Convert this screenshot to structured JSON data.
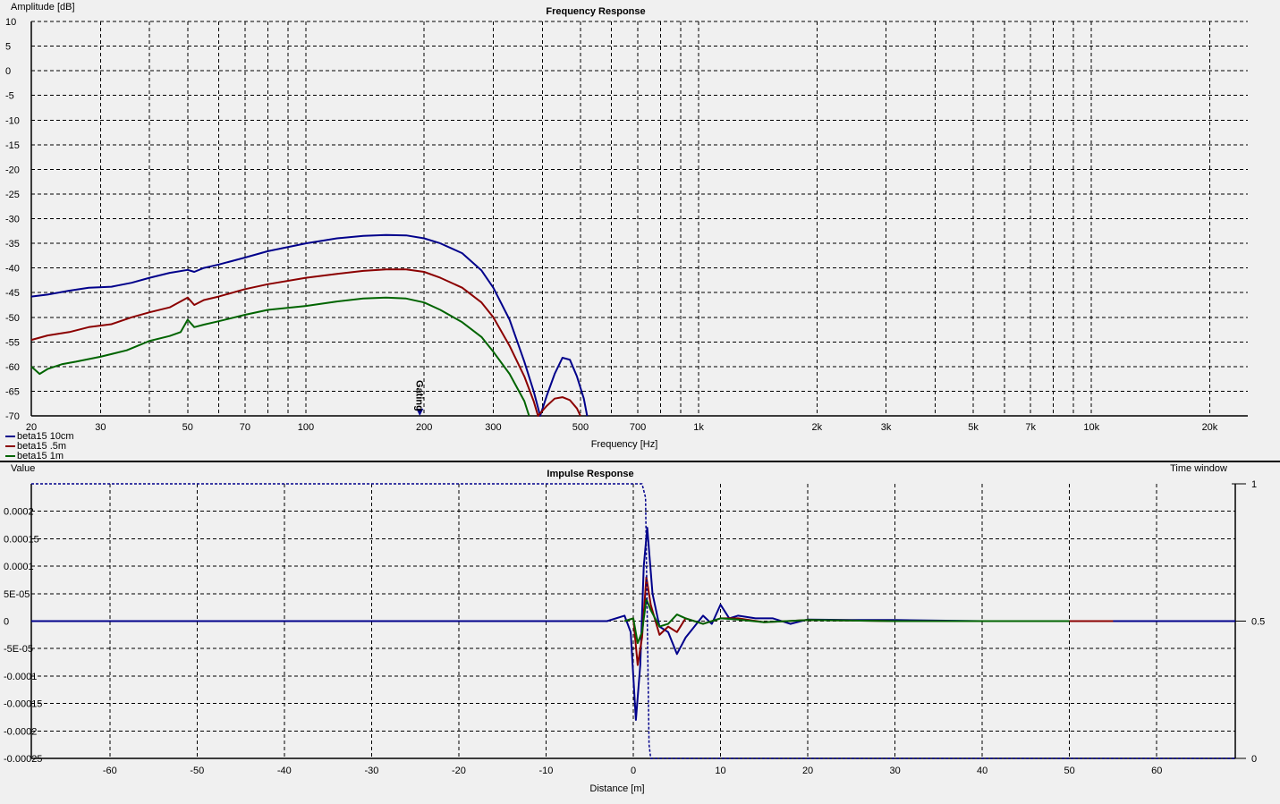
{
  "chart_data": [
    {
      "type": "line",
      "title": "Frequency Response",
      "xlabel": "Frequency [Hz]",
      "ylabel": "Amplitude [dB]",
      "xscale": "log",
      "xlim": [
        20,
        25000
      ],
      "ylim": [
        -70,
        10
      ],
      "grid": true,
      "x_ticks": [
        {
          "value": 20,
          "label": "20"
        },
        {
          "value": 30,
          "label": "30"
        },
        {
          "value": 50,
          "label": "50"
        },
        {
          "value": 70,
          "label": "70"
        },
        {
          "value": 100,
          "label": "100"
        },
        {
          "value": 200,
          "label": "200"
        },
        {
          "value": 300,
          "label": "300"
        },
        {
          "value": 500,
          "label": "500"
        },
        {
          "value": 700,
          "label": "700"
        },
        {
          "value": 1000,
          "label": "1k"
        },
        {
          "value": 2000,
          "label": "2k"
        },
        {
          "value": 3000,
          "label": "3k"
        },
        {
          "value": 5000,
          "label": "5k"
        },
        {
          "value": 7000,
          "label": "7k"
        },
        {
          "value": 10000,
          "label": "10k"
        },
        {
          "value": 20000,
          "label": "20k"
        }
      ],
      "y_ticks": [
        "10",
        "5",
        "0",
        "-5",
        "-10",
        "-15",
        "-20",
        "-25",
        "-30",
        "-35",
        "-40",
        "-45",
        "-50",
        "-55",
        "-60",
        "-65",
        "-70"
      ],
      "marker": {
        "label": "Gating",
        "x": 195
      },
      "legend": {
        "position": "bottom-left"
      },
      "series": [
        {
          "name": "beta15 10cm",
          "color": "#00008b",
          "x": [
            20,
            22,
            25,
            28,
            32,
            36,
            40,
            45,
            50,
            52,
            55,
            60,
            70,
            80,
            100,
            120,
            140,
            160,
            180,
            200,
            220,
            250,
            280,
            300,
            330,
            360,
            380,
            395,
            410,
            430,
            450,
            470,
            490,
            510,
            520
          ],
          "y": [
            -45.8,
            -45.4,
            -44.6,
            -44,
            -43.8,
            -43,
            -42,
            -41,
            -40.4,
            -40.8,
            -40,
            -39.3,
            -37.9,
            -36.6,
            -35,
            -34,
            -33.5,
            -33.3,
            -33.4,
            -34,
            -35,
            -37,
            -40.5,
            -44,
            -50.5,
            -59,
            -65,
            -70,
            -66,
            -61.5,
            -58.2,
            -58.6,
            -62,
            -66.5,
            -70
          ]
        },
        {
          "name": "beta15 .5m",
          "color": "#8b0000",
          "x": [
            20,
            22,
            25,
            28,
            32,
            36,
            40,
            45,
            50,
            52,
            55,
            60,
            70,
            80,
            100,
            120,
            140,
            160,
            180,
            200,
            220,
            250,
            280,
            300,
            330,
            360,
            380,
            390,
            410,
            430,
            450,
            470,
            490,
            500
          ],
          "y": [
            -54.6,
            -53.7,
            -53,
            -52,
            -51.4,
            -50,
            -49,
            -48,
            -46,
            -47.5,
            -46.5,
            -45.8,
            -44.3,
            -43.3,
            -42,
            -41.2,
            -40.6,
            -40.3,
            -40.3,
            -40.8,
            -42,
            -44,
            -47,
            -50,
            -55.8,
            -62,
            -67,
            -70,
            -68,
            -66.5,
            -66.2,
            -66.8,
            -68.5,
            -70
          ]
        },
        {
          "name": "beta15 1m",
          "color": "#006400",
          "x": [
            20,
            21,
            22,
            24,
            26,
            30,
            35,
            40,
            45,
            48,
            50,
            52,
            55,
            60,
            70,
            80,
            100,
            120,
            140,
            160,
            180,
            200,
            220,
            250,
            280,
            300,
            330,
            360,
            370
          ],
          "y": [
            -60,
            -61.5,
            -60.5,
            -59.5,
            -59,
            -58,
            -56.7,
            -54.8,
            -53.8,
            -53,
            -50.5,
            -52,
            -51.5,
            -50.8,
            -49.5,
            -48.5,
            -47.7,
            -46.8,
            -46.2,
            -46,
            -46.2,
            -47,
            -48.5,
            -51,
            -54,
            -57,
            -61.5,
            -67,
            -70
          ]
        }
      ]
    },
    {
      "type": "line",
      "title": "Impulse Response",
      "xlabel": "Distance [m]",
      "ylabel": "Value",
      "y2label": "Time window",
      "xlim": [
        -69,
        69
      ],
      "ylim": [
        -0.00025,
        0.00025
      ],
      "y2lim": [
        0,
        1
      ],
      "grid": true,
      "x_ticks": [
        "-60",
        "-50",
        "-40",
        "-30",
        "-20",
        "-10",
        "0",
        "10",
        "20",
        "30",
        "40",
        "50",
        "60"
      ],
      "y_ticks": [
        "0.0002",
        "0.00015",
        "0.0001",
        "5E-05",
        "0",
        "-5E-05",
        "-0.0001",
        "-0.00015",
        "-0.0002",
        "-0.00025"
      ],
      "y2_ticks": [
        "1",
        "0.5",
        "0"
      ],
      "series": [
        {
          "name": "beta15 10cm",
          "color": "#00008b",
          "x": [
            -69,
            -3,
            -1,
            -0.3,
            0.3,
            0.8,
            1.2,
            1.6,
            2.2,
            3,
            4,
            5,
            6,
            7,
            8,
            9,
            10,
            11,
            12,
            14,
            16,
            18,
            20,
            25,
            30,
            40,
            50,
            60,
            69
          ],
          "y": [
            0,
            0,
            1e-05,
            -2e-05,
            -0.00018,
            -8e-05,
            0.0001,
            0.00017,
            5e-05,
            -1e-05,
            -2e-05,
            -6e-05,
            -3e-05,
            -1e-05,
            1e-05,
            -5e-06,
            3e-05,
            5e-06,
            1e-05,
            5e-06,
            5e-06,
            -5e-06,
            3e-06,
            2e-06,
            2e-06,
            0,
            0,
            0,
            0
          ]
        },
        {
          "name": "beta15 .5m",
          "color": "#8b0000",
          "x": [
            -1,
            0,
            0.5,
            1,
            1.5,
            2,
            3,
            4,
            5,
            6,
            8,
            10,
            12,
            15,
            20,
            30,
            55
          ],
          "y": [
            0,
            5e-06,
            -8e-05,
            -3e-05,
            8e-05,
            3e-05,
            -2.5e-05,
            -1e-05,
            -2e-05,
            5e-06,
            -5e-06,
            5e-06,
            5e-06,
            -2e-06,
            2e-06,
            0,
            0
          ]
        },
        {
          "name": "beta15 1m",
          "color": "#006400",
          "x": [
            -1,
            0,
            0.5,
            1,
            1.5,
            2,
            3,
            4,
            5,
            6,
            8,
            10,
            12,
            15,
            20,
            30,
            50
          ],
          "y": [
            0,
            5e-06,
            -4e-05,
            -2e-05,
            4e-05,
            2e-05,
            -1e-05,
            -5e-06,
            1.2e-05,
            5e-06,
            -5e-06,
            5e-06,
            3e-06,
            -2e-06,
            2e-06,
            0,
            0
          ]
        },
        {
          "name": "Time window",
          "color": "#00008b",
          "axis": "y2",
          "dashed": true,
          "x": [
            -69,
            1,
            1.4,
            1.8,
            2,
            69
          ],
          "y": [
            1,
            1,
            0.95,
            0.05,
            0,
            0
          ]
        }
      ]
    }
  ]
}
